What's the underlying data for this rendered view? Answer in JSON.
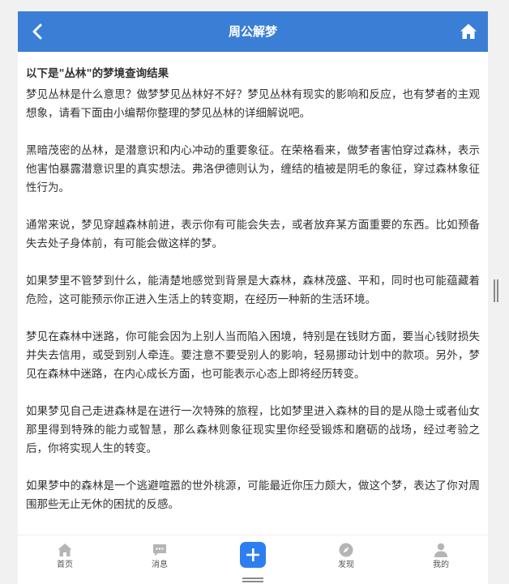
{
  "header": {
    "title": "周公解梦",
    "back_icon": "chevron-left-icon",
    "home_icon": "home-icon",
    "color": "#3a7fd5"
  },
  "content": {
    "heading": "以下是\"丛林\"的梦境查询结果",
    "paragraphs": [
      "梦见丛林是什么意思？做梦梦见丛林好不好？梦见丛林有现实的影响和反应，也有梦者的主观想象，请看下面由小编帮你整理的梦见丛林的详细解说吧。",
      "黑暗茂密的丛林，是潜意识和内心冲动的重要象征。在荣格看来，做梦者害怕穿过森林，表示他害怕暴露潜意识里的真实想法。弗洛伊德则认为，缠结的植被是阴毛的象征，穿过森林象征性行为。",
      "通常来说，梦见穿越森林前进，表示你有可能会失去，或者放弃某方面重要的东西。比如预备失去处子身体前，有可能会做这样的梦。",
      "如果梦里不管梦到什么，能清楚地感觉到背景是大森林，森林茂盛、平和，同时也可能蕴藏着危险，这可能预示你正进入生活上的转变期，在经历一种新的生活环境。",
      "梦见在森林中迷路，你可能会因为上别人当而陷入困境，特别是在钱财方面，要当心钱财损失并失去信用，或受到别人牵连。要注意不要受别人的影响，轻易挪动计划中的款项。另外，梦见在森林中迷路，在内心成长方面，也可能表示心态上即将经历转变。",
      "如果梦见自己走进森林是在进行一次特殊的旅程，比如梦里进入森林的目的是从隐士或者仙女那里得到特殊的能力或智慧，那么森林则象征现实里你经受锻炼和磨砺的战场，经过考验之后，你将实现人生的转变。",
      "如果梦中的森林是一个逃避喧嚣的世外桃源，可能最近你压力颇大，做这个梦，表达了你对周围那些无止无休的困扰的反感。"
    ]
  },
  "nav": {
    "items": [
      {
        "label": "首页",
        "icon": "home-icon"
      },
      {
        "label": "消息",
        "icon": "message-icon"
      },
      {
        "label": "发现",
        "icon": "compass-icon"
      },
      {
        "label": "我的",
        "icon": "user-icon"
      }
    ],
    "add_icon": "plus-icon",
    "add_color": "#2d7ff0",
    "icon_color": "#b5b5b5"
  }
}
